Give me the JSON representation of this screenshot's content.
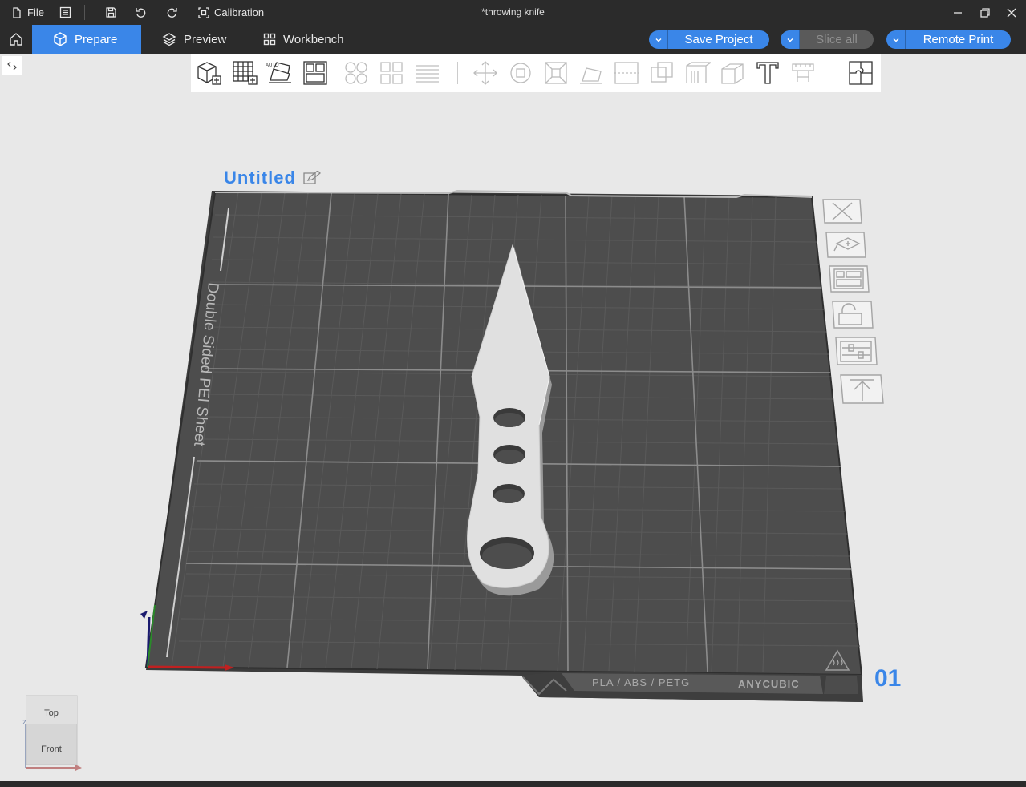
{
  "titlebar": {
    "file_label": "File",
    "calibration_label": "Calibration",
    "document_title": "*throwing knife"
  },
  "tabs": [
    {
      "label": "Prepare",
      "icon": "cube-icon",
      "active": true
    },
    {
      "label": "Preview",
      "icon": "layers-icon",
      "active": false
    },
    {
      "label": "Workbench",
      "icon": "grid-icon",
      "active": false
    }
  ],
  "actions": {
    "save_project": "Save Project",
    "slice_all": "Slice all",
    "remote_print": "Remote Print"
  },
  "plate": {
    "name": "Untitled",
    "sheet_label": "Double Sided PEI Sheet",
    "materials_label": "PLA / ABS / PETG",
    "brand_label": "ANYCUBIC",
    "number": "01"
  },
  "viewcube": {
    "top": "Top",
    "front": "Front",
    "axis_z": "z",
    "axis_x": "x"
  },
  "colors": {
    "accent": "#3a86e8",
    "chrome": "#2b2b2b",
    "bed": "#4a4a4a",
    "model": "#e0e0e0"
  }
}
